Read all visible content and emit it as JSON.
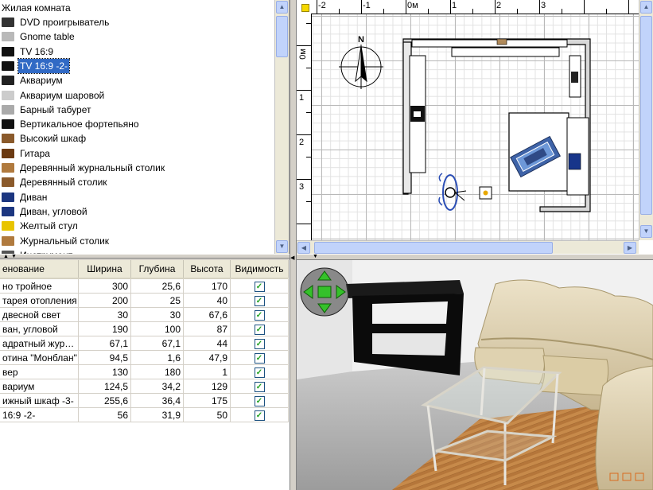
{
  "catalog": {
    "category": "Жилая комната",
    "items": [
      {
        "label": "DVD проигрыватель",
        "icon": "dvd-player-icon",
        "selected": false
      },
      {
        "label": "Gnome table",
        "icon": "gnome-table-icon",
        "selected": false
      },
      {
        "label": "TV 16:9",
        "icon": "tv-icon",
        "selected": false
      },
      {
        "label": "TV 16:9 -2-",
        "icon": "tv-icon",
        "selected": true
      },
      {
        "label": "Аквариум",
        "icon": "aquarium-icon",
        "selected": false
      },
      {
        "label": "Аквариум шаровой",
        "icon": "round-aquarium-icon",
        "selected": false
      },
      {
        "label": "Барный табурет",
        "icon": "bar-stool-icon",
        "selected": false
      },
      {
        "label": "Вертикальное фортепьяно",
        "icon": "piano-icon",
        "selected": false
      },
      {
        "label": "Высокий шкаф",
        "icon": "tall-cabinet-icon",
        "selected": false
      },
      {
        "label": "Гитара",
        "icon": "guitar-icon",
        "selected": false
      },
      {
        "label": "Деревянный журнальный столик",
        "icon": "coffee-table-icon",
        "selected": false
      },
      {
        "label": "Деревянный столик",
        "icon": "wooden-table-icon",
        "selected": false
      },
      {
        "label": "Диван",
        "icon": "sofa-icon",
        "selected": false
      },
      {
        "label": "Диван, угловой",
        "icon": "corner-sofa-icon",
        "selected": false
      },
      {
        "label": "Желтый стул",
        "icon": "yellow-chair-icon",
        "selected": false
      },
      {
        "label": "Журнальный столик",
        "icon": "coffee-table-icon",
        "selected": false
      },
      {
        "label": "Инструмент",
        "icon": "instrument-icon",
        "selected": false
      }
    ]
  },
  "furniture_table": {
    "columns": [
      "енование",
      "Ширина",
      "Глубина",
      "Высота",
      "Видимость"
    ],
    "rows": [
      {
        "name": "но тройное",
        "width": "300",
        "depth": "25,6",
        "height": "170",
        "visible": true
      },
      {
        "name": "тарея отопления",
        "width": "200",
        "depth": "25",
        "height": "40",
        "visible": true
      },
      {
        "name": "двесной свет",
        "width": "30",
        "depth": "30",
        "height": "67,6",
        "visible": true
      },
      {
        "name": "ван, угловой",
        "width": "190",
        "depth": "100",
        "height": "87",
        "visible": true
      },
      {
        "name": "адратный жур…",
        "width": "67,1",
        "depth": "67,1",
        "height": "44",
        "visible": true
      },
      {
        "name": "отина \"Монблан\"",
        "width": "94,5",
        "depth": "1,6",
        "height": "47,9",
        "visible": true
      },
      {
        "name": "вер",
        "width": "130",
        "depth": "180",
        "height": "1",
        "visible": true
      },
      {
        "name": "вариум",
        "width": "124,5",
        "depth": "34,2",
        "height": "129",
        "visible": true
      },
      {
        "name": "ижный шкаф -3-",
        "width": "255,6",
        "depth": "36,4",
        "height": "175",
        "visible": true
      },
      {
        "name": "16:9 -2-",
        "width": "56",
        "depth": "31,9",
        "height": "50",
        "visible": true
      }
    ]
  },
  "plan": {
    "ruler_h": [
      "-2",
      "-1",
      "0м",
      "1",
      "2",
      "3"
    ],
    "ruler_v": [
      "0м",
      "1",
      "2",
      "3"
    ],
    "compass_label": "N"
  },
  "colors": {
    "selection": "#316ac5",
    "check": "#21a121",
    "scroll": "#c1d3fb"
  }
}
